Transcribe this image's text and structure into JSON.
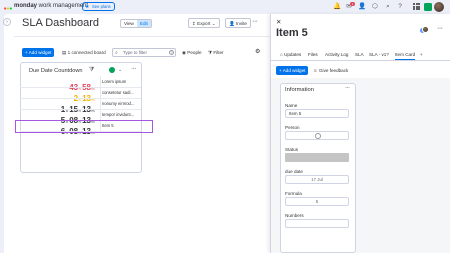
{
  "topbar": {
    "brand_bold": "monday",
    "brand_rest": " work management",
    "see_plans": "See plans",
    "badge_count": "1"
  },
  "board": {
    "title": "SLA Dashboard",
    "view_label": "View",
    "edit_label": "Edit",
    "export_label": "Export",
    "invite_label": "Invite",
    "add_widget_label": "Add widget",
    "connected_label": "1 connected board",
    "search_placeholder": "Type to filter",
    "people_label": "People",
    "filter_label": "Filter"
  },
  "widget": {
    "title": "Due Date Countdown",
    "units": {
      "d": "d",
      "h": "h",
      "m": "m"
    },
    "rows": [
      {
        "d": "",
        "h": "43",
        "m": "58",
        "name": "Lorem ipsum"
      },
      {
        "d": "",
        "h": "2",
        "m": "13",
        "name": "consetetur sadi..."
      },
      {
        "d": "1",
        "h": "15",
        "m": "13",
        "name": "nonumy eirmod..."
      },
      {
        "d": "5",
        "h": "08",
        "m": "13",
        "name": "tempor invidunt..."
      },
      {
        "d": "6",
        "h": "08",
        "m": "13",
        "name": "Item 5"
      }
    ]
  },
  "panel": {
    "title": "Item 5",
    "tabs": [
      "Updates",
      "Files",
      "Activity Log",
      "SLA",
      "SLA - v1?",
      "Item Card"
    ],
    "add_widget_label": "Add widget",
    "feedback_label": "Give feedback",
    "info_title": "Information",
    "fields": {
      "name_label": "Name",
      "name_value": "Item 5",
      "person_label": "Person",
      "status_label": "Status",
      "due_label": "due date",
      "due_value": "17 Jul",
      "formula_label": "Formula",
      "formula_value": "5",
      "numbers_label": "Numbers"
    }
  },
  "colors": {
    "accent": "#0073ea",
    "overdue": "#e2445c",
    "warning": "#f5b000",
    "selection": "#a358df",
    "status_empty": "#c4c4c4"
  }
}
